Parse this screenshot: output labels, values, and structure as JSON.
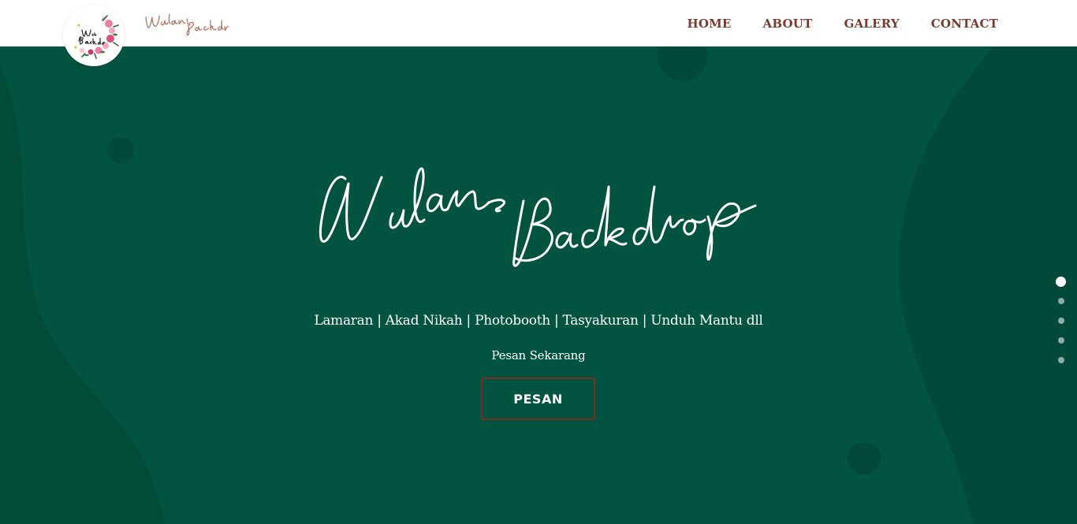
{
  "header": {
    "logo_text": "Wulan Backdrop",
    "brand_script": "Wulan Backdrop",
    "nav": [
      {
        "label": "HOME"
      },
      {
        "label": "ABOUT"
      },
      {
        "label": "GALERY"
      },
      {
        "label": "CONTACT"
      }
    ]
  },
  "hero": {
    "title_script": "Wulan Backdrop",
    "services": "Lamaran | Akad Nikah | Photobooth | Tasyakuran | Unduh Mantu dll",
    "subtitle": "Pesan Sekarang",
    "button_label": "PESAN"
  },
  "slider": {
    "active_index": 0,
    "dot_count": 5
  },
  "colors": {
    "header_bg": "#ffffff",
    "hero_bg": "#025441",
    "nav_text": "#7a3a2e",
    "button_border": "#7a2e22",
    "text_white": "#ffffff"
  }
}
